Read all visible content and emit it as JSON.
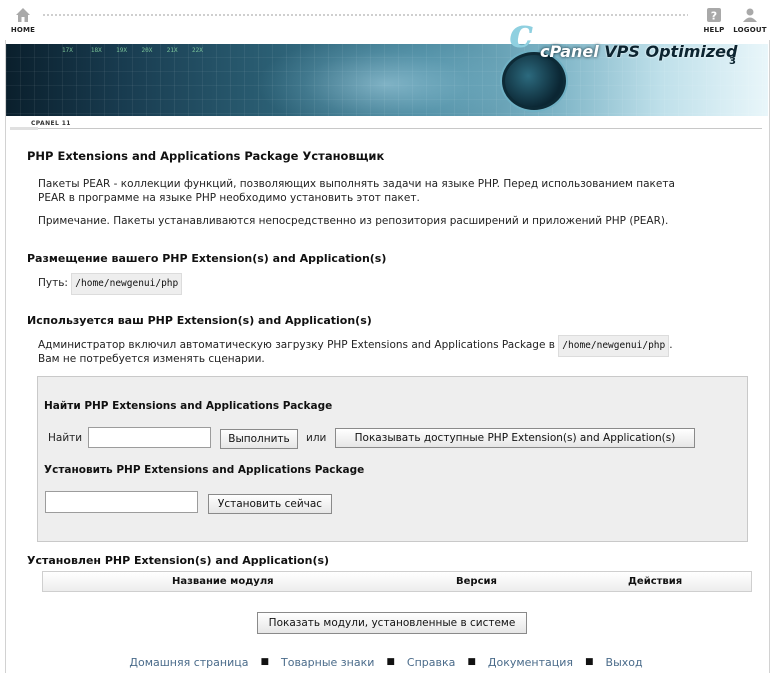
{
  "topbar": {
    "home_label": "HOME",
    "help_label": "HELP",
    "logout_label": "LOGOUT"
  },
  "banner": {
    "brand_c": "c",
    "brand_cpanel": "cPanel",
    "brand_vps": "VPS Optimized",
    "brand_version": "3"
  },
  "tab": {
    "label": "CPANEL 11"
  },
  "page": {
    "title": "PHP Extensions and Applications Package Установщик",
    "intro_line1": "Пакеты PEAR - коллекции функций, позволяющих выполнять задачи на языке PHP. Перед использованием пакета",
    "intro_line2": "PEAR в программе на языке PHP необходимо установить этот пакет.",
    "note": "Примечание. Пакеты устанавливаются непосредственно из репозитория расширений и приложений PHP (PEAR)."
  },
  "location": {
    "heading": "Размещение вашего PHP Extension(s) and Application(s)",
    "path_label": "Путь:",
    "path_value": "/home/newgenui/php"
  },
  "usage": {
    "heading": "Используется ваш PHP Extension(s) and Application(s)",
    "line1": "Администратор включил автоматическую загрузку PHP Extensions and Applications Package в",
    "line1_path": "/home/newgenui/php",
    "line1_end": ".",
    "line2": "Вам не потребуется изменять сценарии."
  },
  "search": {
    "heading": "Найти PHP Extensions and Applications Package",
    "find_label": "Найти",
    "input_value": "",
    "go_button": "Выполнить",
    "or_label": "или",
    "show_button": "Показывать доступные PHP Extension(s) and Application(s)"
  },
  "install": {
    "heading": "Установить PHP Extensions and Applications Package",
    "input_value": "",
    "button": "Установить сейчас"
  },
  "installed": {
    "heading": "Установлен PHP Extension(s) and Application(s)",
    "columns": [
      "Название модуля",
      "Версия",
      "Действия"
    ],
    "show_system_button": "Показать модули, установленные в системе"
  },
  "footer": {
    "links": [
      "Домашняя страница",
      "Товарные знаки",
      "Справка",
      "Документация",
      "Выход"
    ],
    "separator": "■"
  }
}
